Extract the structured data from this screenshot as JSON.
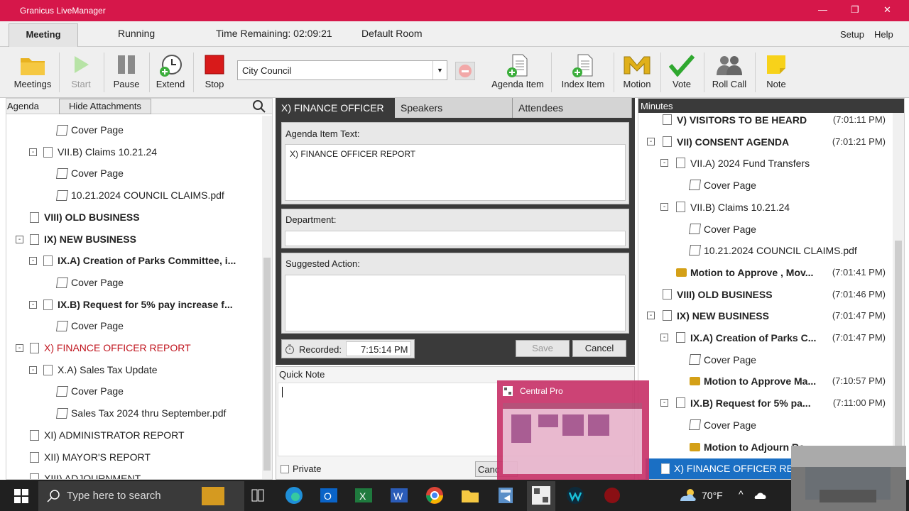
{
  "window": {
    "title": "Granicus LiveManager",
    "minimize": "—",
    "restore": "❐",
    "close": "✕"
  },
  "menubar": {
    "tabs": [
      "Meeting",
      "Running"
    ],
    "time_remaining": "Time Remaining: 02:09:21",
    "room": "Default Room",
    "setup": "Setup",
    "help": "Help"
  },
  "toolbar": {
    "meetings": "Meetings",
    "start": "Start",
    "pause": "Pause",
    "extend": "Extend",
    "stop": "Stop",
    "select_value": "City Council",
    "agenda_item": "Agenda Item",
    "index_item": "Index Item",
    "motion": "Motion",
    "vote": "Vote",
    "roll_call": "Roll Call",
    "note": "Note"
  },
  "left": {
    "header": "Agenda",
    "hide_btn": "Hide Attachments",
    "rows": [
      {
        "label": "Cover Page",
        "indent": 3,
        "icon": "cover",
        "bold": false,
        "exp": ""
      },
      {
        "label": "VII.B) Claims 10.21.24",
        "indent": 2,
        "icon": "doc",
        "bold": false,
        "exp": "⊟"
      },
      {
        "label": "Cover Page",
        "indent": 3,
        "icon": "cover",
        "bold": false,
        "exp": ""
      },
      {
        "label": "10.21.2024 COUNCIL CLAIMS.pdf",
        "indent": 3,
        "icon": "cover",
        "bold": false,
        "exp": ""
      },
      {
        "label": "VIII) OLD BUSINESS",
        "indent": 1,
        "icon": "doc",
        "bold": true,
        "exp": ""
      },
      {
        "label": "IX) NEW BUSINESS",
        "indent": 1,
        "icon": "doc",
        "bold": true,
        "exp": "⊟"
      },
      {
        "label": "IX.A) Creation of Parks Committee, i...",
        "indent": 2,
        "icon": "doc",
        "bold": true,
        "exp": "⊟"
      },
      {
        "label": "Cover Page",
        "indent": 3,
        "icon": "cover",
        "bold": false,
        "exp": ""
      },
      {
        "label": "IX.B) Request for 5% pay increase f...",
        "indent": 2,
        "icon": "doc",
        "bold": true,
        "exp": "⊟"
      },
      {
        "label": "Cover Page",
        "indent": 3,
        "icon": "cover",
        "bold": false,
        "exp": ""
      },
      {
        "label": "X) FINANCE OFFICER REPORT",
        "indent": 1,
        "icon": "doc",
        "bold": false,
        "exp": "⊟",
        "red": true
      },
      {
        "label": "X.A) Sales Tax Update",
        "indent": 2,
        "icon": "doc",
        "bold": false,
        "exp": "⊟"
      },
      {
        "label": "Cover Page",
        "indent": 3,
        "icon": "cover",
        "bold": false,
        "exp": ""
      },
      {
        "label": "Sales Tax 2024 thru September.pdf",
        "indent": 3,
        "icon": "cover",
        "bold": false,
        "exp": ""
      },
      {
        "label": "XI) ADMINISTRATOR REPORT",
        "indent": 1,
        "icon": "doc",
        "bold": false,
        "exp": ""
      },
      {
        "label": "XII) MAYOR'S REPORT",
        "indent": 1,
        "icon": "doc",
        "bold": false,
        "exp": ""
      },
      {
        "label": "XIII) ADJOURNMENT",
        "indent": 1,
        "icon": "doc",
        "bold": false,
        "exp": ""
      }
    ]
  },
  "center": {
    "tabs": [
      "X) FINANCE OFFICER R...",
      "Speakers",
      "Attendees"
    ],
    "agenda_item_text_label": "Agenda Item Text:",
    "agenda_item_text": "X) FINANCE OFFICER REPORT",
    "department_label": "Department:",
    "suggested_action_label": "Suggested Action:",
    "recorded_label": "Recorded:",
    "recorded_time": "7:15:14 PM",
    "save": "Save",
    "cancel": "Cancel"
  },
  "quicknote": {
    "header": "Quick Note",
    "private": "Private",
    "cancel_partial": "Canc"
  },
  "popup": {
    "title": "Central Pro"
  },
  "right": {
    "header": "Minutes",
    "rows": [
      {
        "label": "V) VISITORS TO BE HEARD",
        "time": "(7:01:11 PM)",
        "indent": 1,
        "icon": "doc",
        "bold": true,
        "exp": ""
      },
      {
        "label": "VII) CONSENT AGENDA",
        "time": "(7:01:21 PM)",
        "indent": 1,
        "icon": "doc",
        "bold": true,
        "exp": "⊟"
      },
      {
        "label": "VII.A) 2024 Fund Transfers",
        "time": "",
        "indent": 2,
        "icon": "doc",
        "bold": false,
        "exp": "⊟"
      },
      {
        "label": "Cover Page",
        "time": "",
        "indent": 3,
        "icon": "cover",
        "bold": false,
        "exp": ""
      },
      {
        "label": "VII.B) Claims 10.21.24",
        "time": "",
        "indent": 2,
        "icon": "doc",
        "bold": false,
        "exp": "⊟"
      },
      {
        "label": "Cover Page",
        "time": "",
        "indent": 3,
        "icon": "cover",
        "bold": false,
        "exp": ""
      },
      {
        "label": "10.21.2024 COUNCIL CLAIMS.pdf",
        "time": "",
        "indent": 3,
        "icon": "cover",
        "bold": false,
        "exp": ""
      },
      {
        "label": "Motion to Approve , Mov...",
        "time": "(7:01:41 PM)",
        "indent": 2,
        "icon": "motion",
        "bold": true,
        "exp": ""
      },
      {
        "label": "VIII) OLD BUSINESS",
        "time": "(7:01:46 PM)",
        "indent": 1,
        "icon": "doc",
        "bold": true,
        "exp": ""
      },
      {
        "label": "IX) NEW BUSINESS",
        "time": "(7:01:47 PM)",
        "indent": 1,
        "icon": "doc",
        "bold": true,
        "exp": "⊟"
      },
      {
        "label": "IX.A) Creation of Parks C...",
        "time": "(7:01:47 PM)",
        "indent": 2,
        "icon": "doc",
        "bold": true,
        "exp": "⊟"
      },
      {
        "label": "Cover Page",
        "time": "",
        "indent": 3,
        "icon": "cover",
        "bold": false,
        "exp": ""
      },
      {
        "label": "Motion to Approve Ma...",
        "time": "(7:10:57 PM)",
        "indent": 3,
        "icon": "motion",
        "bold": true,
        "exp": ""
      },
      {
        "label": "IX.B) Request for 5% pa...",
        "time": "(7:11:00 PM)",
        "indent": 2,
        "icon": "doc",
        "bold": true,
        "exp": "⊟"
      },
      {
        "label": "Cover Page",
        "time": "",
        "indent": 3,
        "icon": "cover",
        "bold": false,
        "exp": ""
      },
      {
        "label": "Motion to Adjourn Re...",
        "time": "",
        "indent": 3,
        "icon": "motion",
        "bold": true,
        "exp": ""
      }
    ],
    "selected": "X) FINANCE OFFICER REP"
  },
  "taskbar": {
    "search_placeholder": "Type here to search",
    "weather": "70°F"
  },
  "colors": {
    "brand": "#d6174a",
    "selected_blue": "#1a6fc4",
    "red_text": "#c0141e"
  }
}
